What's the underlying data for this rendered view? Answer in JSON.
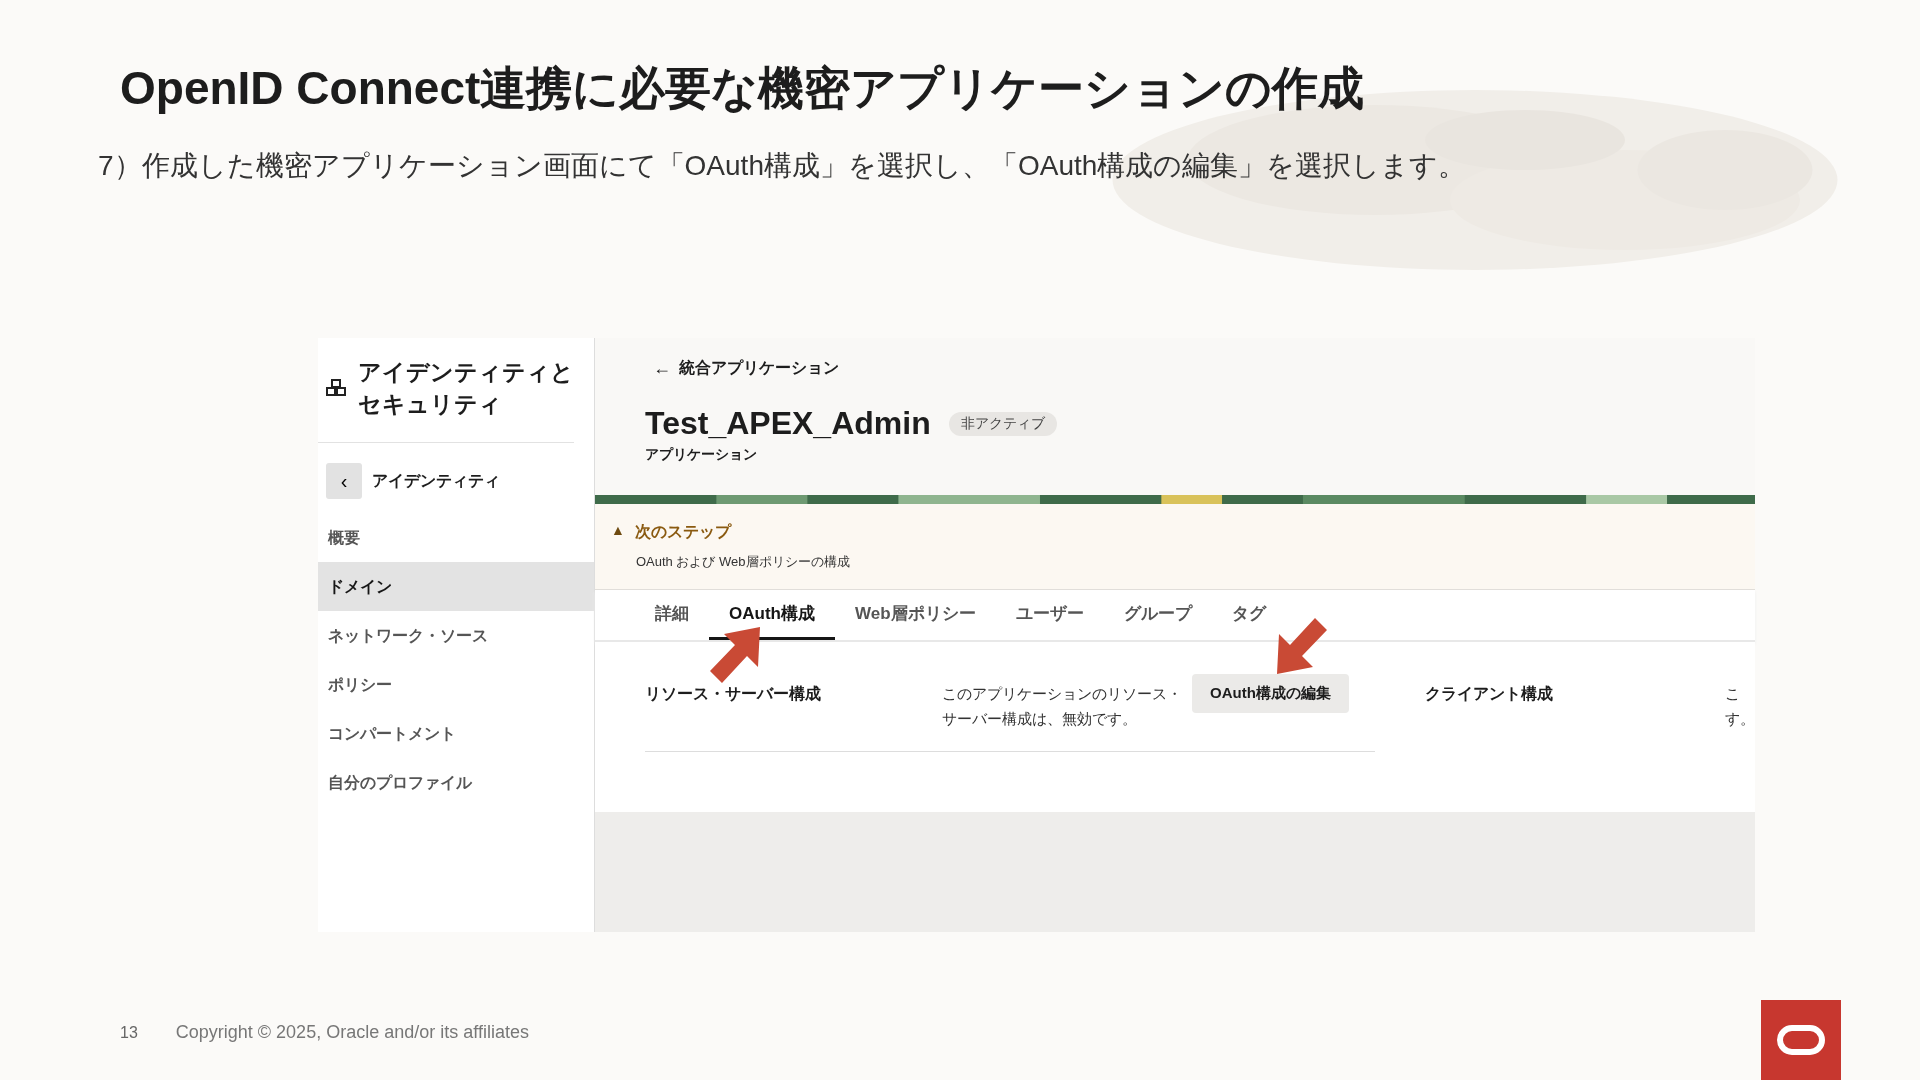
{
  "slide": {
    "title": "OpenID Connect連携に必要な機密アプリケーションの作成",
    "instruction": "7）作成した機密アプリケーション画面にて「OAuth構成」を選択し、「OAuth構成の編集」を選択します。"
  },
  "screenshot": {
    "sidebar": {
      "title_lines": [
        "アイデンティティと",
        "セキュリティ"
      ],
      "back_button": "‹",
      "back_label": "アイデンティティ",
      "items": [
        {
          "label": "概要",
          "selected": false
        },
        {
          "label": "ドメイン",
          "selected": true
        },
        {
          "label": "ネットワーク・ソース",
          "selected": false
        },
        {
          "label": "ポリシー",
          "selected": false
        },
        {
          "label": "コンパートメント",
          "selected": false
        },
        {
          "label": "自分のプロファイル",
          "selected": false
        }
      ]
    },
    "header": {
      "breadcrumb_arrow": "←",
      "breadcrumb": "統合アプリケーション",
      "app_name": "Test_APEX_Admin",
      "status_badge": "非アクティブ",
      "subtitle": "アプリケーション"
    },
    "notice": {
      "icon": "▲",
      "title": "次のステップ",
      "text": "OAuth および Web層ポリシーの構成"
    },
    "tabs": [
      {
        "label": "詳細",
        "selected": false
      },
      {
        "label": "OAuth構成",
        "selected": true
      },
      {
        "label": "Web層ポリシー",
        "selected": false
      },
      {
        "label": "ユーザー",
        "selected": false
      },
      {
        "label": "グループ",
        "selected": false
      },
      {
        "label": "タグ",
        "selected": false
      }
    ],
    "resource": {
      "heading": "リソース・サーバー構成",
      "description": "このアプリケーションのリソース・サーバー構成は、無効です。",
      "edit_button": "OAuth構成の編集"
    },
    "client": {
      "heading": "クライアント構成",
      "description_lines": [
        "こ",
        "す。"
      ]
    }
  },
  "footer": {
    "page_number": "13",
    "copyright": "Copyright © 2025, Oracle and/or its affiliates"
  }
}
